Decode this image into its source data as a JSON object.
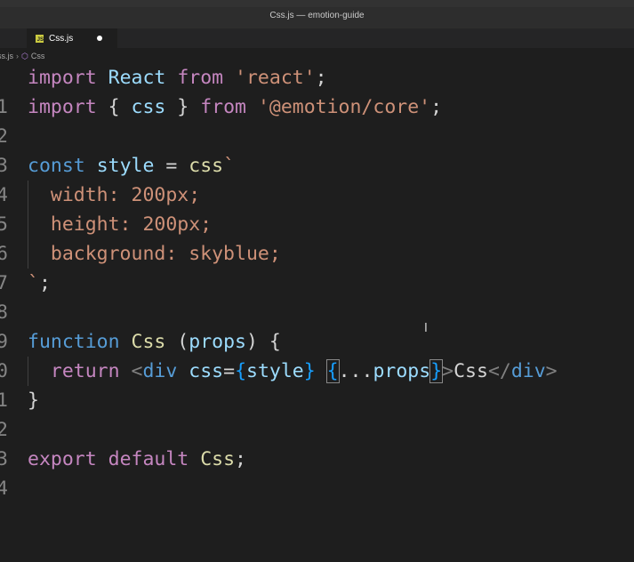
{
  "window": {
    "title": "Css.js — emotion-guide"
  },
  "tab": {
    "label": "Css.js",
    "icon": "js-file-icon",
    "modified": true
  },
  "breadcrumb": {
    "file": "ss.js",
    "symbol": "Css"
  },
  "editor": {
    "line_numbers": [
      "1",
      "2",
      "3",
      "4",
      "5",
      "6",
      "7",
      "8",
      "9",
      "0",
      "1",
      "2",
      "3",
      "4"
    ],
    "lines": {
      "l1": [
        "import",
        " ",
        "React",
        " ",
        "from",
        " ",
        "'react'",
        ";"
      ],
      "l2": [
        "import",
        " { ",
        "css",
        " } ",
        "from",
        " ",
        "'@emotion/core'",
        ";"
      ],
      "l4": [
        "const",
        " ",
        "style",
        " = ",
        "css",
        "`"
      ],
      "l5": [
        "  width: 200px;"
      ],
      "l6": [
        "  height: 200px;"
      ],
      "l7": [
        "  background: skyblue;"
      ],
      "l8": [
        "`",
        ";"
      ],
      "l10": [
        "function",
        " ",
        "Css",
        " (",
        "props",
        ") {"
      ],
      "l11": [
        "  ",
        "return",
        " ",
        "<",
        "div",
        " ",
        "css",
        "=",
        "{",
        "style",
        "}",
        " ",
        "{",
        "...",
        "props",
        "}",
        ">",
        "Css",
        "</",
        "div",
        ">"
      ],
      "l12": [
        "}"
      ],
      "l14": [
        "export",
        " ",
        "default",
        " ",
        "Css",
        ";"
      ]
    }
  },
  "colors": {
    "background": "#1e1e1e",
    "keyword_control": "#c586c0",
    "keyword_storage": "#569cd6",
    "variable": "#9cdcfe",
    "class": "#4ec9b0",
    "function": "#dcdcaa",
    "string": "#ce9178"
  }
}
